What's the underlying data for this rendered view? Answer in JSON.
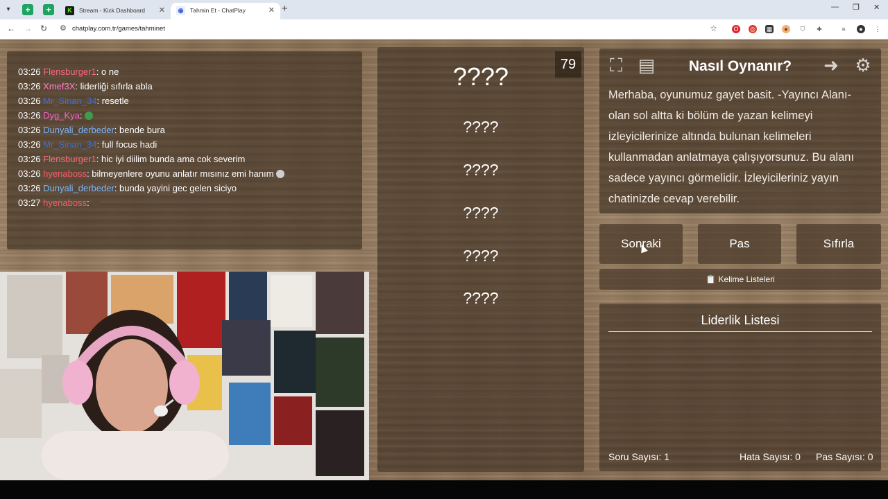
{
  "browser": {
    "tabs": [
      {
        "label": "Stream - Kick Dashboard"
      },
      {
        "label": "Tahmin Et - ChatPlay"
      }
    ],
    "url": "chatplay.com.tr/games/tahminet"
  },
  "chat": {
    "messages": [
      {
        "time": "03:26",
        "user": "Flensburger1",
        "color": "#ff6a7d",
        "text": ": o ne"
      },
      {
        "time": "03:26",
        "user": "Xmef3X",
        "color": "#ff7ecb",
        "text": ": liderliği sıfırla abla"
      },
      {
        "time": "03:26",
        "user": "Mr_Sinan_34",
        "color": "#3e6fcf",
        "text": ": resetle"
      },
      {
        "time": "03:26",
        "user": "Dyg_Kya",
        "color": "#ff5fd0",
        "text": ":"
      },
      {
        "time": "03:26",
        "user": "Dunyali_derbeder",
        "color": "#7fb7ff",
        "text": ": bende bura"
      },
      {
        "time": "03:26",
        "user": "Mr_Sinan_34",
        "color": "#3e6fcf",
        "text": ": full focus hadi"
      },
      {
        "time": "03:26",
        "user": "Flensburger1",
        "color": "#ff6a7d",
        "text": ": hic iyi diilim bunda ama cok severim"
      },
      {
        "time": "03:26",
        "user": "hyenaboss",
        "color": "#ff5a6e",
        "text": ": bilmeyenlere oyunu anlatır mısınız emi hanım"
      },
      {
        "time": "03:26",
        "user": "Dunyali_derbeder",
        "color": "#7fb7ff",
        "text": ": bunda yayini gec gelen siciyo"
      },
      {
        "time": "03:27",
        "user": "hyenaboss",
        "color": "#ff5a6e",
        "text": ":"
      }
    ]
  },
  "game": {
    "counter": "79",
    "main_word": "????",
    "taboo_words": [
      "????",
      "????",
      "????",
      "????",
      "????"
    ]
  },
  "howto": {
    "title": "Nasıl Oynanır?",
    "text": "Merhaba, oyunumuz gayet basit. -Yayıncı Alanı- olan sol altta ki bölüm de yazan kelimeyi izleyicilerinize altında bulunan kelimeleri kullanmadan anlatmaya çalışıyorsunuz. Bu alanı sadece yayıncı görmelidir. İzleyicileriniz yayın chatinizde cevap verebilir."
  },
  "controls": {
    "next": "Sonraki",
    "pass": "Pas",
    "reset": "Sıfırla",
    "word_lists": "Kelime Listeleri"
  },
  "leaderboard": {
    "title": "Liderlik Listesi",
    "questions": "Soru Sayısı: 1",
    "errors": "Hata Sayısı: 0",
    "passes": "Pas Sayısı: 0"
  }
}
